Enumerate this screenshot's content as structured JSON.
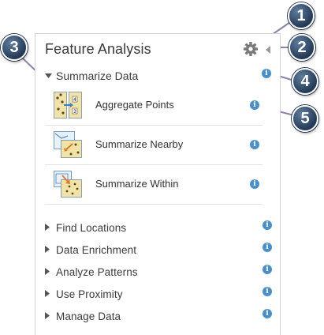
{
  "panel": {
    "title": "Feature Analysis",
    "settings_icon": "gear-icon",
    "collapse_icon": "triangle-left-icon"
  },
  "section": {
    "label": "Summarize Data",
    "expanded": true,
    "tools": [
      {
        "label": "Aggregate Points",
        "icon": "aggregate-points-icon"
      },
      {
        "label": "Summarize Nearby",
        "icon": "summarize-nearby-icon"
      },
      {
        "label": "Summarize Within",
        "icon": "summarize-within-icon"
      }
    ]
  },
  "categories": [
    {
      "label": "Find Locations"
    },
    {
      "label": "Data Enrichment"
    },
    {
      "label": "Analyze Patterns"
    },
    {
      "label": "Use Proximity"
    },
    {
      "label": "Manage Data"
    }
  ],
  "info_glyph": "i",
  "callouts": [
    "1",
    "2",
    "3",
    "4",
    "5"
  ],
  "colors": {
    "info": "#4a90c8",
    "callout": "#243b58",
    "leader": "#8c82a8"
  }
}
